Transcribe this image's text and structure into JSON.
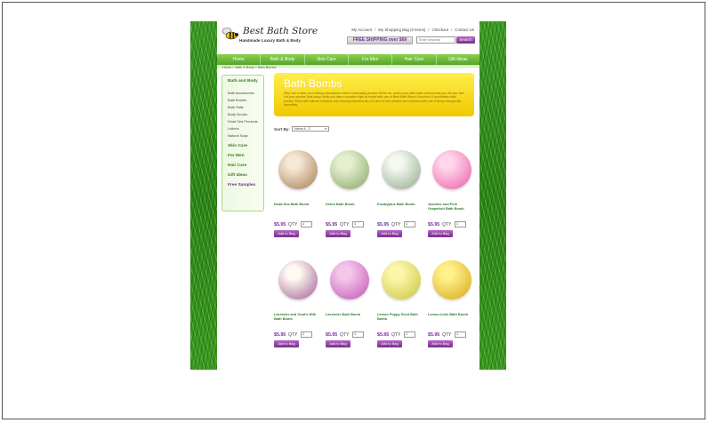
{
  "logo": {
    "name": "Best Bath Store",
    "tagline": "Handmade Luxury Bath & Body"
  },
  "toplinks": [
    "My Account",
    "My Shopping Bag (0 items)",
    "Checkout",
    "Contact Us"
  ],
  "freeship": "FREE SHIPPING over $69",
  "search": {
    "placeholder": "Enter keyword",
    "button": "Search"
  },
  "nav": [
    "Home",
    "Bath & Body",
    "Skin Care",
    "For Men",
    "Hair Care",
    "Gift Ideas"
  ],
  "breadcrumb": "Home > Bath & Body > Bath Bombs",
  "sidebar": {
    "heading": "Bath and Body",
    "subitems": [
      "Bath Accessories",
      "Bath Bombs",
      "Bath Salts",
      "Body Scrubs",
      "Dead Sea Products",
      "Lotions",
      "Natural Soap"
    ],
    "categories": [
      "Skin Care",
      "For Men",
      "Hair Care",
      "Gift Ideas",
      "Free Samples"
    ]
  },
  "banner": {
    "title": "Bath Bombs",
    "desc": "Step into a warm and inviting atmosphere where intoxicating aromas fill the air, watch your bath water and aromas you off your feet. Let your worries float away, while you take a vacation right at home with one of Best Bath Store's luxurious & scrubbable bath bombs. Filled with intense moisture and relaxing essential oils, it's time to feel relaxed and renewed with one of these therapeutic favourites."
  },
  "sort": {
    "label": "Sort By:",
    "value": "Name A - Z"
  },
  "qty_label": "QTY",
  "add_label": "Add to Bag",
  "qty_default": "1",
  "products": [
    {
      "name": "Dead Sea Bath Bomb",
      "price": "$5.95",
      "c1": "#f5e8d4",
      "c2": "#a67a52"
    },
    {
      "name": "Detox Bath Bomb",
      "price": "$5.95",
      "c1": "#e6f0d0",
      "c2": "#86a464"
    },
    {
      "name": "Eucalyptus Bath Bomb",
      "price": "$5.95",
      "c1": "#f4f8f0",
      "c2": "#8ea888"
    },
    {
      "name": "Jasmine and Pink Grapefruit Bath Bomb",
      "price": "$5.95",
      "c1": "#ffd6ea",
      "c2": "#ec5aa6"
    },
    {
      "name": "Lavender and Goat's Milk Bath Bomb",
      "price": "$5.95",
      "c1": "#fffaf0",
      "c2": "#a05a96"
    },
    {
      "name": "Lavender Bath Bomb",
      "price": "$5.95",
      "c1": "#f4c6ea",
      "c2": "#c054b4"
    },
    {
      "name": "Lemon Poppy Seed Bath Bomb",
      "price": "$5.95",
      "c1": "#fbf6aa",
      "c2": "#ccc23c"
    },
    {
      "name": "Lemon-Lime Bath Bomb",
      "price": "$5.95",
      "c1": "#fff08a",
      "c2": "#d6a616"
    }
  ]
}
